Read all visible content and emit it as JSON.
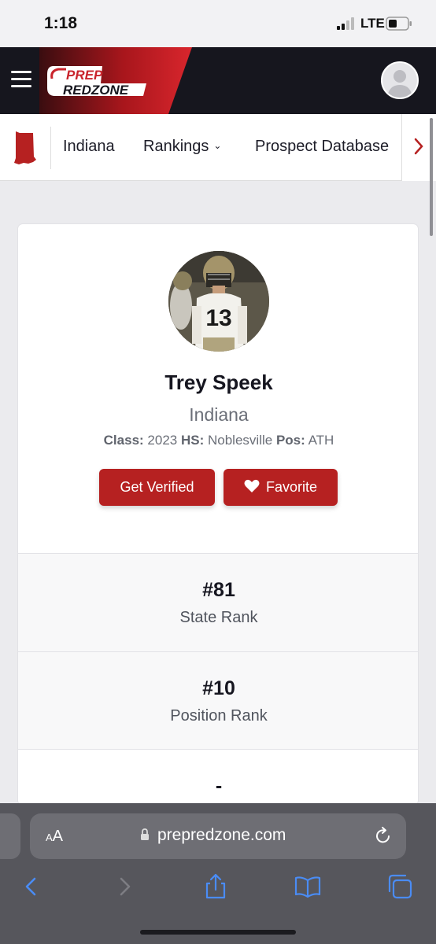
{
  "status_bar": {
    "time": "1:18",
    "network": "LTE"
  },
  "header": {
    "logo_top": "PREP",
    "logo_bottom": "REDZONE",
    "brand_red": "#c9242c"
  },
  "subnav": {
    "items": [
      {
        "label": "Indiana"
      },
      {
        "label": "Rankings"
      },
      {
        "label": "Prospect Database"
      }
    ]
  },
  "profile": {
    "name": "Trey Speek",
    "state": "Indiana",
    "class_label": "Class:",
    "class_value": "2023",
    "hs_label": "HS:",
    "hs_value": "Noblesville",
    "pos_label": "Pos:",
    "pos_value": "ATH",
    "jersey": "13",
    "verify_button": "Get Verified",
    "favorite_button": "Favorite"
  },
  "rankings": [
    {
      "value": "#81",
      "label": "State Rank"
    },
    {
      "value": "#10",
      "label": "Position Rank"
    },
    {
      "value": "-",
      "label": ""
    }
  ],
  "browser": {
    "aa_large": "A",
    "aa_small": "A",
    "url": "prepredzone.com"
  }
}
